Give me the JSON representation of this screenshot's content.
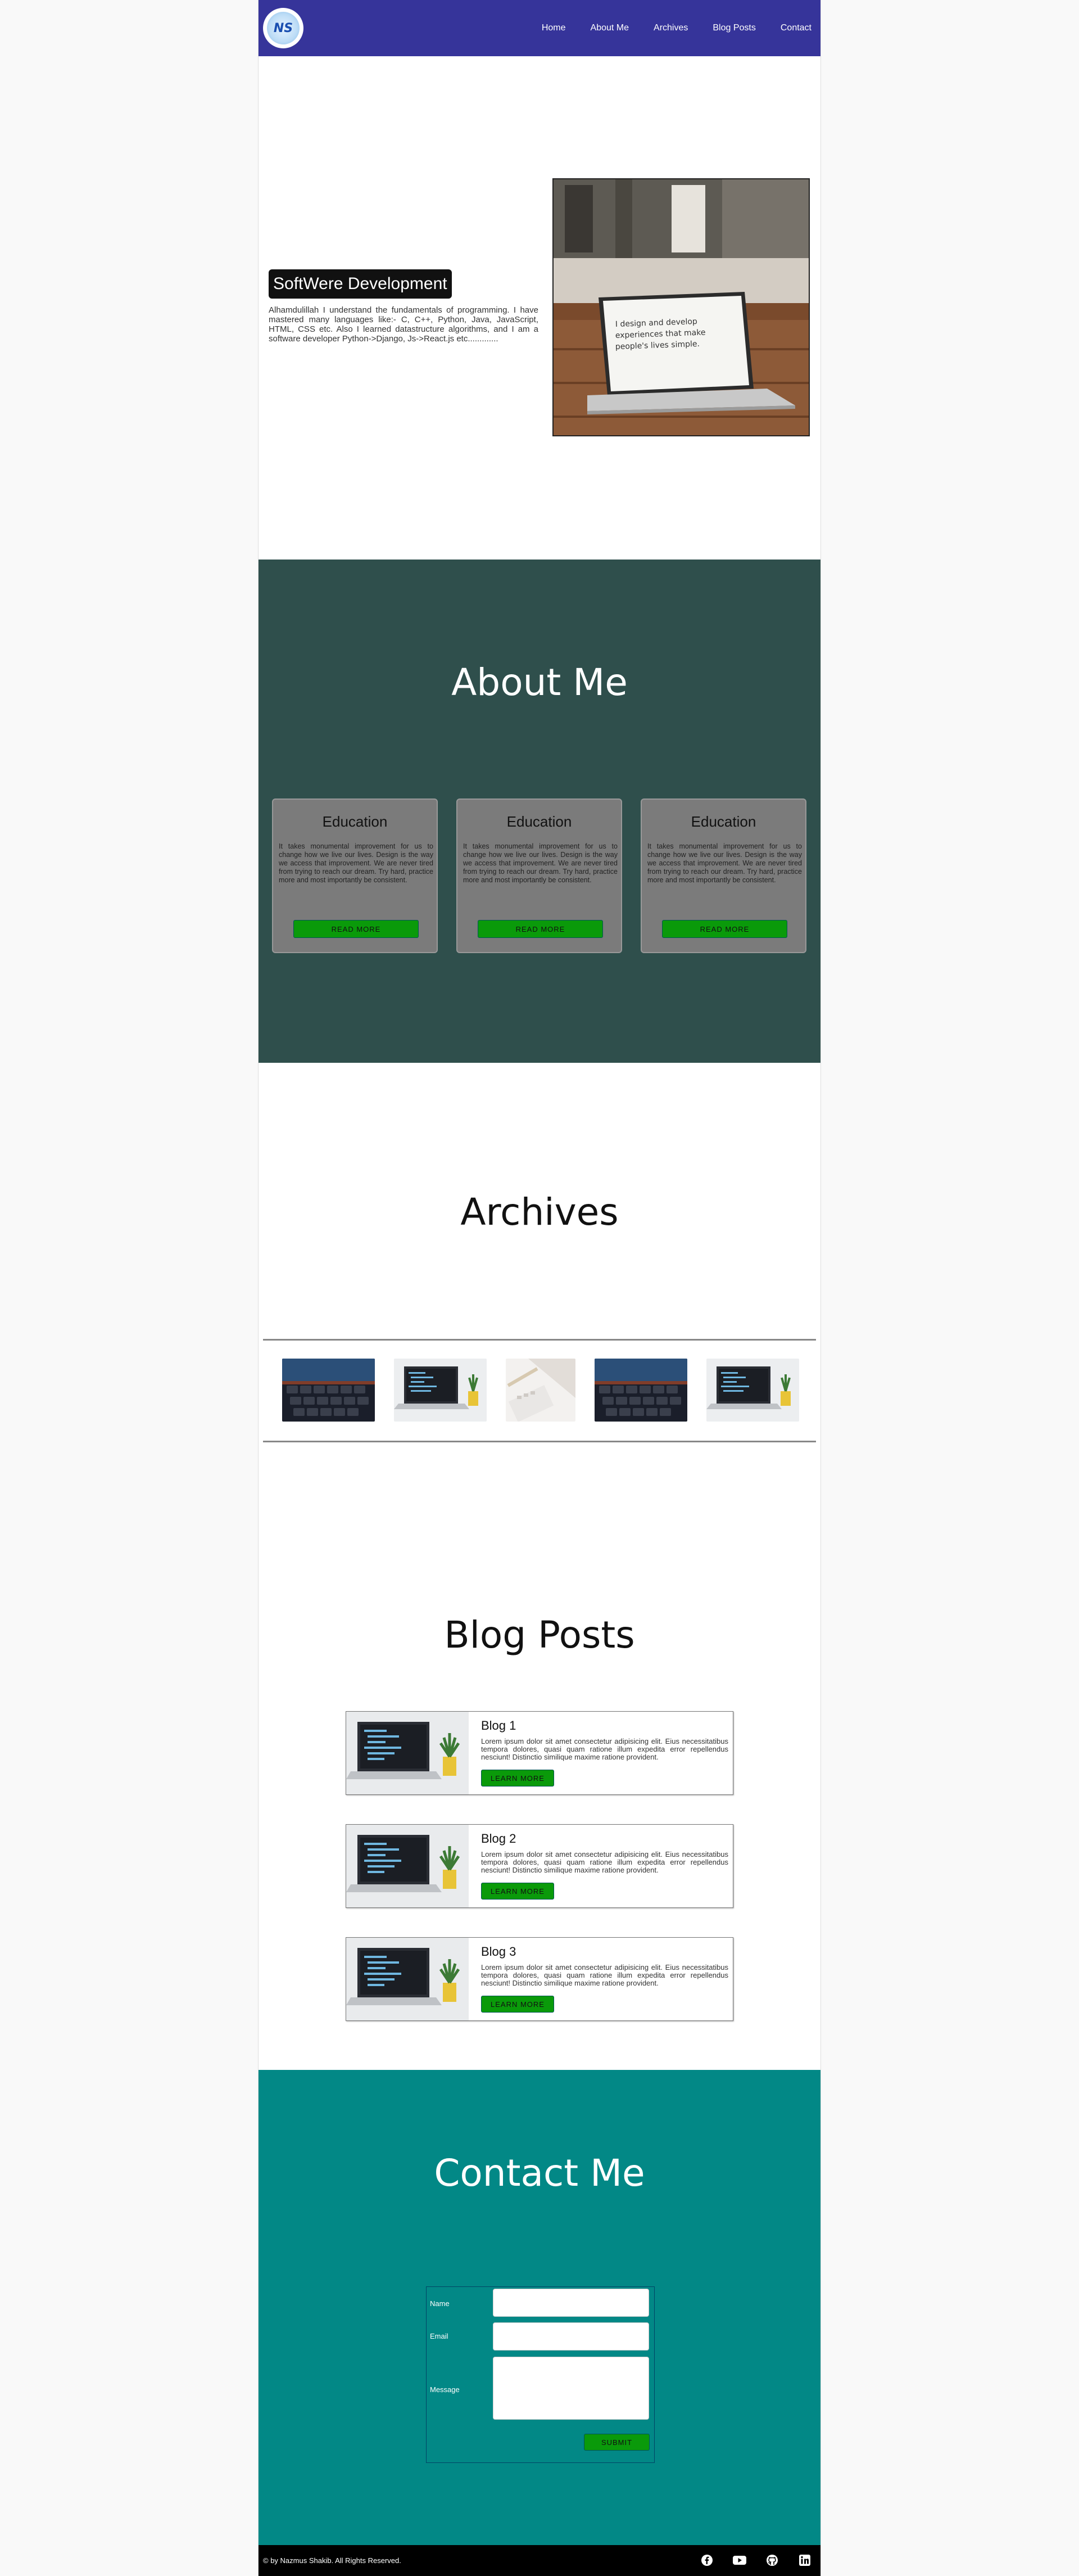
{
  "nav": {
    "logo_text": "NS",
    "links": [
      "Home",
      "About Me",
      "Archives",
      "Blog Posts",
      "Contact"
    ]
  },
  "hero": {
    "title": "SoftWere Development",
    "text": "Alhamdulillah I understand the fundamentals of programming. I have mastered many languages like:- C, C++, Python, Java, JavaScript, HTML, CSS etc. Also I learned datastructure algorithms, and I am a software developer Python->Django, Js->React.js etc.............",
    "image_text": "I design and develop experiences that make people's lives simple."
  },
  "about": {
    "heading": "About Me",
    "cards": [
      {
        "title": "Education",
        "text": "It takes monumental improvement for us to change how we live our lives. Design is the way we access that improvement. We are never tired from trying to reach our dream. Try hard, practice more and most importantly be consistent.",
        "button": "READ MORE"
      },
      {
        "title": "Education",
        "text": "It takes monumental improvement for us to change how we live our lives. Design is the way we access that improvement. We are never tired from trying to reach our dream. Try hard, practice more and most importantly be consistent.",
        "button": "READ MORE"
      },
      {
        "title": "Education",
        "text": "It takes monumental improvement for us to change how we live our lives. Design is the way we access that improvement. We are never tired from trying to reach our dream. Try hard, practice more and most importantly be consistent.",
        "button": "READ MORE"
      }
    ]
  },
  "archives": {
    "heading": "Archives"
  },
  "blog": {
    "heading": "Blog Posts",
    "posts": [
      {
        "title": "Blog 1",
        "text": "Lorem ipsum dolor sit amet consectetur adipisicing elit. Eius necessitatibus tempora dolores, quasi quam ratione illum expedita error repellendus nesciunt! Distinctio similique maxime ratione provident.",
        "button": "LEARN MORE"
      },
      {
        "title": "Blog 2",
        "text": "Lorem ipsum dolor sit amet consectetur adipisicing elit. Eius necessitatibus tempora dolores, quasi quam ratione illum expedita error repellendus nesciunt! Distinctio similique maxime ratione provident.",
        "button": "LEARN MORE"
      },
      {
        "title": "Blog 3",
        "text": "Lorem ipsum dolor sit amet consectetur adipisicing elit. Eius necessitatibus tempora dolores, quasi quam ratione illum expedita error repellendus nesciunt! Distinctio similique maxime ratione provident.",
        "button": "LEARN MORE"
      }
    ]
  },
  "contact": {
    "heading": "Contact Me",
    "name_label": "Name",
    "email_label": "Email",
    "message_label": "Message",
    "submit": "SUBMIT"
  },
  "footer": {
    "copyright": "© by Nazmus Shakib. All Rights Reserved.",
    "icons": [
      "facebook-icon",
      "youtube-icon",
      "github-icon",
      "linkedin-icon"
    ]
  },
  "colors": {
    "nav": "#36349a",
    "about_bg": "#2f4f4c",
    "contact_bg": "#028886",
    "button": "#0a9a0a"
  }
}
